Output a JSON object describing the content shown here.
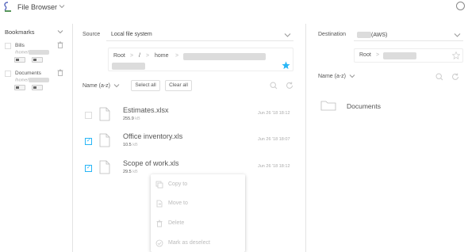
{
  "header": {
    "title": "File Browser"
  },
  "sidebar": {
    "title": "Bookmarks",
    "items": [
      {
        "name": "Bills",
        "path_prefix": "/home/"
      },
      {
        "name": "Documents",
        "path_prefix": "/home/"
      }
    ]
  },
  "source": {
    "label": "Source",
    "selected": "Local file system",
    "breadcrumb": [
      "Root",
      "/",
      "home"
    ],
    "sort_label": "Name (a-z)",
    "select_all": "Select all",
    "clear_all": "Clear all",
    "files": [
      {
        "name": "Estimates.xlsx",
        "size": "255.9",
        "unit": "kB",
        "date": "Jun 26 '18 18:12",
        "checked": false
      },
      {
        "name": "Office inventory.xls",
        "size": "10.5",
        "unit": "kB",
        "date": "Jun 26 '18 18:07",
        "checked": true
      },
      {
        "name": "Scope of work.xls",
        "size": "29.5",
        "unit": "kB",
        "date": "Jun 26 '18 18:12",
        "checked": true
      }
    ]
  },
  "context_menu": {
    "items": [
      {
        "label": "Copy to",
        "icon": "copy-icon"
      },
      {
        "label": "Move to",
        "icon": "move-icon"
      },
      {
        "label": "Delete",
        "icon": "trash-icon"
      },
      {
        "label": "Mark as deselect",
        "icon": "check-circle-icon"
      }
    ]
  },
  "destination": {
    "label": "Destination",
    "selected_suffix": "(AWS)",
    "breadcrumb": [
      "Root"
    ],
    "sort_label": "Name (a-z)",
    "folders": [
      {
        "name": "Documents"
      }
    ]
  },
  "colors": {
    "accent": "#29b6f6",
    "logo": "#2e7d32"
  }
}
